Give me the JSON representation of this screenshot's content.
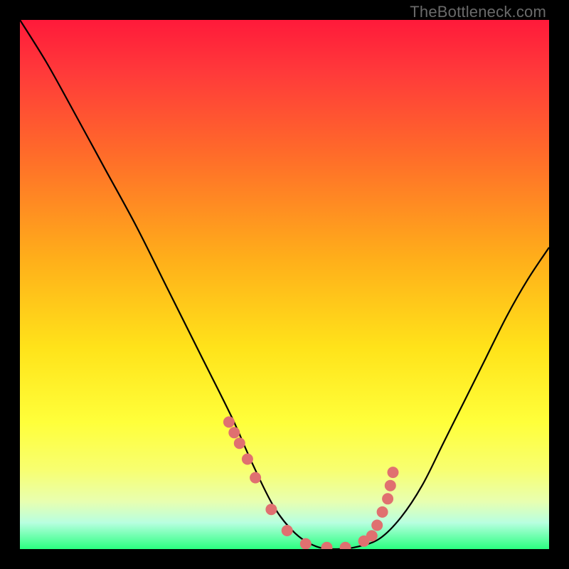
{
  "watermark": "TheBottleneck.com",
  "chart_data": {
    "type": "line",
    "title": "",
    "xlabel": "",
    "ylabel": "",
    "xlim": [
      0,
      1
    ],
    "ylim": [
      0,
      1
    ],
    "series": [
      {
        "name": "curve",
        "x": [
          0.0,
          0.05,
          0.1,
          0.16,
          0.22,
          0.28,
          0.34,
          0.4,
          0.44,
          0.48,
          0.52,
          0.56,
          0.6,
          0.64,
          0.68,
          0.72,
          0.76,
          0.8,
          0.84,
          0.88,
          0.92,
          0.96,
          1.0
        ],
        "y": [
          1.0,
          0.92,
          0.83,
          0.72,
          0.61,
          0.49,
          0.37,
          0.25,
          0.16,
          0.08,
          0.03,
          0.005,
          0.0,
          0.005,
          0.02,
          0.06,
          0.12,
          0.2,
          0.28,
          0.36,
          0.44,
          0.51,
          0.57
        ]
      }
    ],
    "markers": {
      "name": "scatter-dots",
      "color": "#e07070",
      "x": [
        0.395,
        0.405,
        0.415,
        0.43,
        0.445,
        0.475,
        0.505,
        0.54,
        0.58,
        0.615,
        0.65,
        0.665,
        0.675,
        0.685,
        0.695,
        0.7,
        0.705
      ],
      "y": [
        0.24,
        0.22,
        0.2,
        0.17,
        0.135,
        0.075,
        0.035,
        0.01,
        0.003,
        0.003,
        0.015,
        0.025,
        0.045,
        0.07,
        0.095,
        0.12,
        0.145
      ]
    },
    "background": {
      "type": "vertical-gradient",
      "stops": [
        {
          "pos": 0.0,
          "color": "#ff1a3a"
        },
        {
          "pos": 0.25,
          "color": "#ff6a2a"
        },
        {
          "pos": 0.5,
          "color": "#ffc81a"
        },
        {
          "pos": 0.75,
          "color": "#ffff3a"
        },
        {
          "pos": 1.0,
          "color": "#2aff80"
        }
      ]
    }
  }
}
